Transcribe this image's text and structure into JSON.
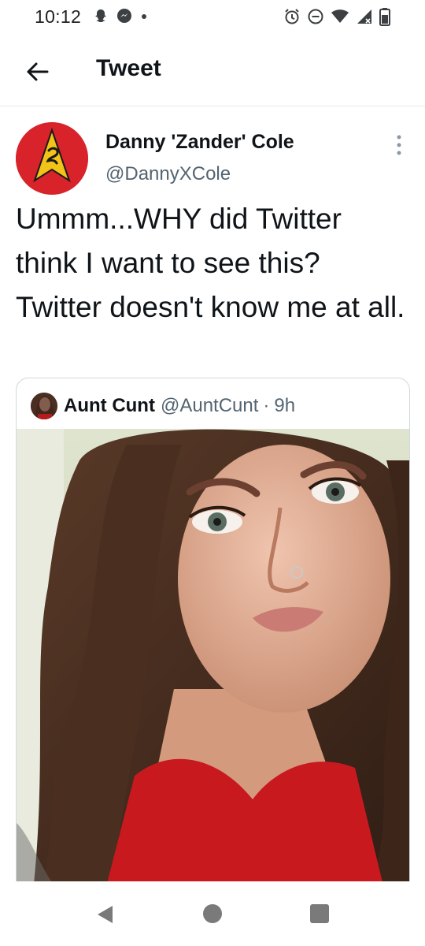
{
  "status_bar": {
    "time": "10:12",
    "left_icons": [
      "snapchat-icon",
      "messenger-icon",
      "notification-dot-icon"
    ],
    "right_icons": [
      "alarm-icon",
      "do-not-disturb-icon",
      "wifi-icon",
      "signal-icon",
      "battery-icon"
    ]
  },
  "header": {
    "title": "Tweet",
    "back_icon": "arrow-left-icon"
  },
  "tweet": {
    "author_name": "Danny 'Zander' Cole",
    "author_handle": "@DannyXCole",
    "text": "Ummm...WHY did Twitter think I want to see this? Twitter doesn't know me at all.",
    "more_icon": "more-vertical-icon",
    "avatar_colors": {
      "background": "#d9232b",
      "badge": "#f2c318"
    }
  },
  "quoted_tweet": {
    "author_name": "Aunt Cunt",
    "author_handle": "@AuntCunt",
    "separator": "·",
    "time_ago": "9h",
    "media": "selfie-photo"
  },
  "nav_bar": {
    "icons": [
      "back-triangle-icon",
      "home-circle-icon",
      "recents-square-icon"
    ]
  },
  "colors": {
    "text_primary": "#0f1419",
    "text_secondary": "#536471",
    "border": "#cfd9de"
  }
}
